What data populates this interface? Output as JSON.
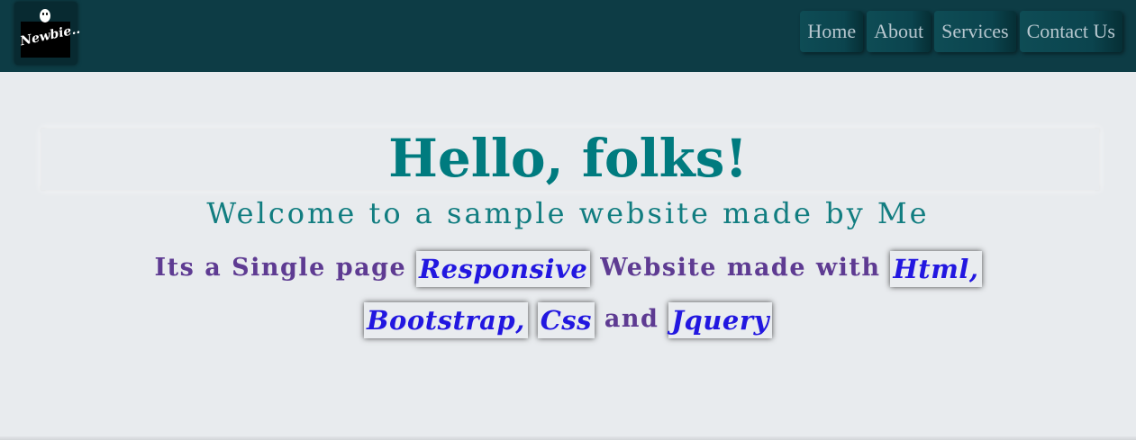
{
  "navbar": {
    "logo_text": "Newbie..",
    "links": [
      "Home",
      "About",
      "Services",
      "Contact Us"
    ]
  },
  "hero": {
    "title": "Hello, folks!",
    "subtitle": "Welcome to a sample website made by Me",
    "desc_part1": "Its a Single page",
    "tag_responsive": "Responsive",
    "desc_part2": "Website made with",
    "tag_html": "Html,",
    "tag_bootstrap": "Bootstrap,",
    "tag_css": "Css",
    "desc_and": "and",
    "tag_jquery": "Jquery"
  },
  "colors": {
    "navbar_bg": "#0d3c45",
    "page_bg": "#e8ebee",
    "title": "#007b7f",
    "desc": "#5e3b92",
    "tag": "#2217e0"
  }
}
